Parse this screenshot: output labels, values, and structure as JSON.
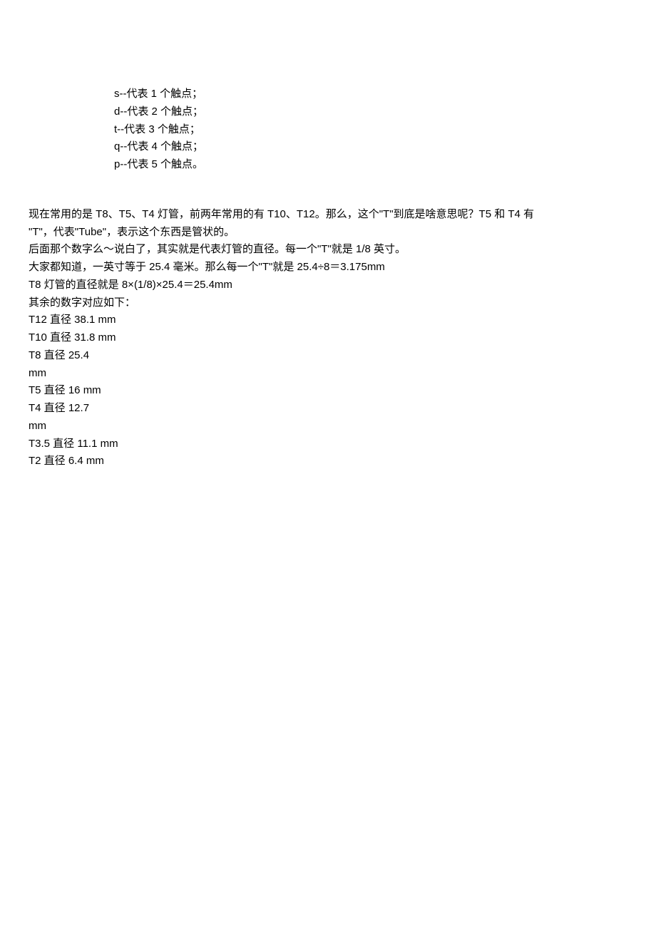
{
  "indented": {
    "line1": "s--代表 1 个触点；",
    "line2": "d--代表 2 个触点；",
    "line3": "t--代表 3 个触点；",
    "line4": "q--代表 4 个触点；",
    "line5": "p--代表 5 个触点。"
  },
  "main": {
    "line1": "现在常用的是 T8、T5、T4 灯管，前两年常用的有 T10、T12。那么，这个\"T\"到底是啥意思呢？T5 和 T4 有",
    "line2": "\"T\"，代表\"Tube\"，表示这个东西是管状的。",
    "line3": "后面那个数字么～说白了，其实就是代表灯管的直径。每一个\"T\"就是 1/8 英寸。",
    "line4": "大家都知道，一英寸等于 25.4 毫米。那么每一个\"T\"就是 25.4÷8＝3.175mm",
    "line5": "T8 灯管的直径就是 8×(1/8)×25.4＝25.4mm",
    "line6": "其余的数字对应如下：",
    "line7": "T12 直径 38.1 mm",
    "line8": "T10 直径 31.8 mm",
    "line9": "T8 直径 25.4",
    "line10": "mm",
    "line11": "T5 直径 16 mm",
    "line12": "T4 直径 12.7",
    "line13": "mm",
    "line14": "T3.5 直径 11.1 mm",
    "line15": "T2 直径 6.4 mm"
  }
}
